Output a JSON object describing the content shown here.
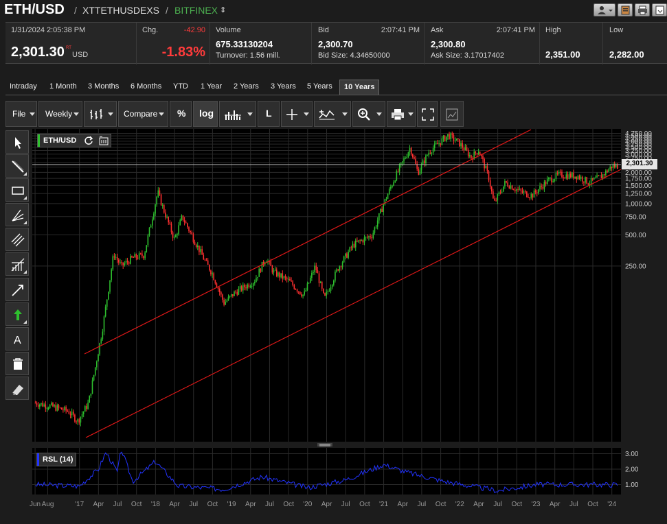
{
  "header": {
    "symbol": "ETH/USD",
    "sep1": "/",
    "ticker": "XTTETHUSDEXS",
    "sep2": "/",
    "exchange": "BITFINEX",
    "exchange_arrow": "⇕"
  },
  "quote": {
    "datetime": "1/31/2024 2:05:38 PM",
    "last": "2,301.30",
    "last_sup": "RT",
    "currency": "USD",
    "chg_label": "Chg.",
    "chg_value": "-42.90",
    "chg_pct": "-1.83%",
    "volume_label": "Volume",
    "volume_value": "675.33130204",
    "turnover": "Turnover: 1.56 mill.",
    "bid_label": "Bid",
    "bid_time": "2:07:41 PM",
    "bid_value": "2,300.70",
    "bid_size": "Bid Size: 4.34650000",
    "ask_label": "Ask",
    "ask_time": "2:07:41 PM",
    "ask_value": "2,300.80",
    "ask_size": "Ask Size: 3.17017402",
    "high_label": "High",
    "high_value": "2,351.00",
    "low_label": "Low",
    "low_value": "2,282.00"
  },
  "tabs": [
    "Intraday",
    "1 Month",
    "3 Months",
    "6 Months",
    "YTD",
    "1 Year",
    "2 Years",
    "3 Years",
    "5 Years",
    "10 Years"
  ],
  "active_tab": "10 Years",
  "toolbar": {
    "file": "File",
    "interval": "Weekly",
    "compare": "Compare",
    "percent": "%",
    "log": "log",
    "line": "L"
  },
  "side_tools": [
    "pointer-icon",
    "line-draw-icon",
    "rectangle-icon",
    "fibonacci-icon",
    "parallel-channel-icon",
    "gann-icon",
    "arrow-line-icon",
    "up-arrow-icon",
    "text-icon",
    "trash-icon",
    "eraser-icon"
  ],
  "chart_legend": {
    "symbol": "ETH/USD",
    "indicator": "RSL (14)"
  },
  "colors": {
    "up": "#2ec02e",
    "down": "#ff3030",
    "trendline": "#e01818",
    "rsl": "#2233ff",
    "background": "#000000"
  },
  "chart_data": [
    {
      "type": "candlestick",
      "scale": "log",
      "interval": "weekly",
      "y_ticks": [
        "250.00",
        "500.00",
        "750.00",
        "1,000.00",
        "1,250.00",
        "1,500.00",
        "1,750.00",
        "2,000.00",
        "2,250.00",
        "2,500.00",
        "2,750.00",
        "3,000.00",
        "3,250.00",
        "3,500.00",
        "3,750.00",
        "4,000.00",
        "4,250.00",
        "4,500.00",
        "4,750.00"
      ],
      "last_price_label": "2,301.30",
      "x_ticks": [
        "Jun",
        "Aug",
        "'17",
        "Apr",
        "Jul",
        "Oct",
        "'18",
        "Apr",
        "Jul",
        "Oct",
        "'19",
        "Apr",
        "Jul",
        "Oct",
        "'20",
        "Apr",
        "Jul",
        "Oct",
        "'21",
        "Apr",
        "Jul",
        "Oct",
        "'22",
        "Apr",
        "Jul",
        "Oct",
        "'23",
        "Apr",
        "Jul",
        "Oct",
        "'24"
      ],
      "approx_close_series": [
        {
          "t": 2016.42,
          "v": 12
        },
        {
          "t": 2016.65,
          "v": 11
        },
        {
          "t": 2016.85,
          "v": 10
        },
        {
          "t": 2016.98,
          "v": 8
        },
        {
          "t": 2017.12,
          "v": 12
        },
        {
          "t": 2017.3,
          "v": 60
        },
        {
          "t": 2017.45,
          "v": 330
        },
        {
          "t": 2017.55,
          "v": 250
        },
        {
          "t": 2017.7,
          "v": 300
        },
        {
          "t": 2017.85,
          "v": 320
        },
        {
          "t": 2017.95,
          "v": 700
        },
        {
          "t": 2018.03,
          "v": 1300
        },
        {
          "t": 2018.1,
          "v": 900
        },
        {
          "t": 2018.25,
          "v": 450
        },
        {
          "t": 2018.35,
          "v": 750
        },
        {
          "t": 2018.5,
          "v": 460
        },
        {
          "t": 2018.65,
          "v": 280
        },
        {
          "t": 2018.75,
          "v": 210
        },
        {
          "t": 2018.9,
          "v": 110
        },
        {
          "t": 2019.05,
          "v": 140
        },
        {
          "t": 2019.3,
          "v": 180
        },
        {
          "t": 2019.45,
          "v": 300
        },
        {
          "t": 2019.55,
          "v": 220
        },
        {
          "t": 2019.75,
          "v": 180
        },
        {
          "t": 2019.95,
          "v": 130
        },
        {
          "t": 2020.1,
          "v": 250
        },
        {
          "t": 2020.22,
          "v": 120
        },
        {
          "t": 2020.4,
          "v": 240
        },
        {
          "t": 2020.6,
          "v": 400
        },
        {
          "t": 2020.85,
          "v": 500
        },
        {
          "t": 2021.0,
          "v": 1000
        },
        {
          "t": 2021.15,
          "v": 1800
        },
        {
          "t": 2021.35,
          "v": 3500
        },
        {
          "t": 2021.45,
          "v": 2000
        },
        {
          "t": 2021.6,
          "v": 3200
        },
        {
          "t": 2021.85,
          "v": 4600
        },
        {
          "t": 2022.0,
          "v": 3800
        },
        {
          "t": 2022.15,
          "v": 2800
        },
        {
          "t": 2022.25,
          "v": 3300
        },
        {
          "t": 2022.38,
          "v": 1800
        },
        {
          "t": 2022.45,
          "v": 1000
        },
        {
          "t": 2022.6,
          "v": 1600
        },
        {
          "t": 2022.8,
          "v": 1300
        },
        {
          "t": 2022.95,
          "v": 1200
        },
        {
          "t": 2023.15,
          "v": 1650
        },
        {
          "t": 2023.3,
          "v": 1900
        },
        {
          "t": 2023.55,
          "v": 1850
        },
        {
          "t": 2023.7,
          "v": 1600
        },
        {
          "t": 2023.85,
          "v": 1800
        },
        {
          "t": 2024.0,
          "v": 2300
        },
        {
          "t": 2024.08,
          "v": 2301.3
        }
      ]
    },
    {
      "type": "line",
      "name": "RSL (14)",
      "y_ticks": [
        "1.00",
        "2.00",
        "3.00"
      ],
      "approx_series": [
        {
          "t": 2016.42,
          "v": 1.0
        },
        {
          "t": 2017.0,
          "v": 0.9
        },
        {
          "t": 2017.25,
          "v": 2.0
        },
        {
          "t": 2017.35,
          "v": 3.1
        },
        {
          "t": 2017.5,
          "v": 1.8
        },
        {
          "t": 2017.55,
          "v": 3.3
        },
        {
          "t": 2017.7,
          "v": 1.2
        },
        {
          "t": 2018.0,
          "v": 2.5
        },
        {
          "t": 2018.3,
          "v": 0.9
        },
        {
          "t": 2018.9,
          "v": 0.7
        },
        {
          "t": 2019.4,
          "v": 1.5
        },
        {
          "t": 2020.0,
          "v": 0.8
        },
        {
          "t": 2020.5,
          "v": 1.3
        },
        {
          "t": 2021.0,
          "v": 2.3
        },
        {
          "t": 2021.3,
          "v": 1.8
        },
        {
          "t": 2021.8,
          "v": 1.2
        },
        {
          "t": 2022.5,
          "v": 0.6
        },
        {
          "t": 2023.0,
          "v": 1.0
        },
        {
          "t": 2024.08,
          "v": 1.0
        }
      ]
    }
  ]
}
